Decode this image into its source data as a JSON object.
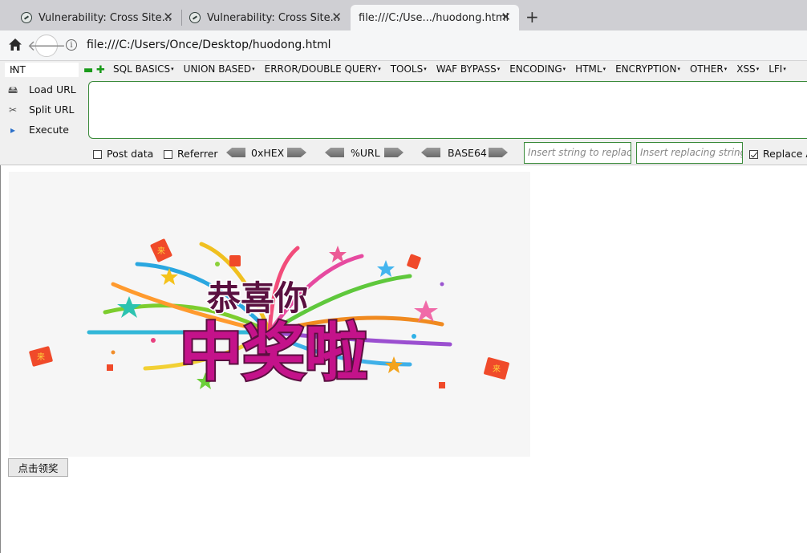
{
  "tabs": [
    {
      "title": "Vulnerability: Cross Site..."
    },
    {
      "title": "Vulnerability: Cross Site..."
    },
    {
      "title": "file:///C:/Use.../huodong.html"
    }
  ],
  "address": {
    "url": "file:///C:/Users/Once/Desktop/huodong.html"
  },
  "hackbar": {
    "type_select": "INT",
    "menus": [
      "SQL BASICS",
      "UNION BASED",
      "ERROR/DOUBLE QUERY",
      "TOOLS",
      "WAF BYPASS",
      "ENCODING",
      "HTML",
      "ENCRYPTION",
      "OTHER",
      "XSS",
      "LFI"
    ],
    "load_url": "Load URL",
    "split_url": "Split URL",
    "execute": "Execute",
    "post_data": "Post data",
    "referrer": "Referrer",
    "hex": "0xHEX",
    "url_enc": "%URL",
    "base64": "BASE64",
    "replace_placeholder": "Insert string to replace",
    "replacing_placeholder": "Insert replacing string",
    "replace_all": "Replace A"
  },
  "page": {
    "banner_line1": "恭喜你",
    "banner_line2": "中奖啦",
    "claim_button": "点击领奖",
    "envelope_char": "来"
  },
  "colors": {
    "accent_green": "#3a8a3a",
    "banner_magenta": "#c4128a",
    "banner_dark": "#5a1040"
  }
}
